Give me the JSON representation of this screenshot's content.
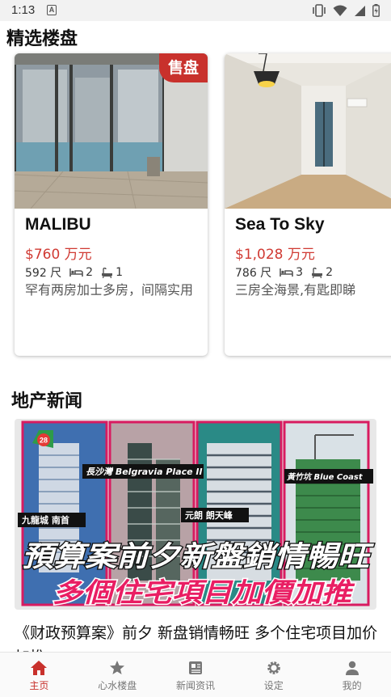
{
  "status_bar": {
    "time": "1:13",
    "notification_letter": "A"
  },
  "featured": {
    "title": "精选楼盘",
    "badge": "售盘",
    "cards": [
      {
        "name": "MALIBU",
        "price": "$760 万元",
        "area": "592 尺",
        "bedrooms": "2",
        "bathrooms": "1",
        "description": "罕有两房加士多房，间隔实用"
      },
      {
        "name": "Sea To Sky",
        "price": "$1,028 万元",
        "area": "786 尺",
        "bedrooms": "3",
        "bathrooms": "2",
        "description": "三房全海景,有匙即睇"
      }
    ]
  },
  "news": {
    "title": "地产新闻",
    "headline": "《财政预算案》前夕 新盘销情畅旺 多个住宅项目加价加推",
    "image_text": {
      "badge": "28",
      "label_1": "長沙灣 Belgravia Place II",
      "label_2": "黃竹坑 Blue Coast",
      "label_3": "九龍城 南首",
      "label_4": "元朗 朗天峰",
      "line_1": "預算案前夕新盤銷情暢旺",
      "line_2": "多個住宅項目加價加推"
    }
  },
  "bottom_nav": {
    "active": "home",
    "items": [
      {
        "key": "home",
        "label": "主页",
        "icon": "home-icon"
      },
      {
        "key": "favorites",
        "label": "心水楼盘",
        "icon": "star-icon"
      },
      {
        "key": "news",
        "label": "新闻资讯",
        "icon": "newspaper-icon"
      },
      {
        "key": "settings",
        "label": "设定",
        "icon": "gear-icon"
      },
      {
        "key": "profile",
        "label": "我的",
        "icon": "person-icon"
      }
    ]
  },
  "colors": {
    "accent": "#c8312c",
    "inactive": "#777777"
  }
}
